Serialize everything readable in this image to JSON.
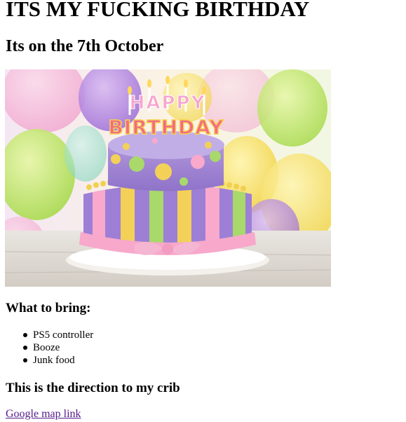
{
  "heading": "ITS MY FUCKING BIRTHDAY",
  "subheading": "Its on the 7th October",
  "image": {
    "cake_topper_line1": "HAPPY",
    "cake_topper_line2": "BIRTHDAY"
  },
  "bring_section": {
    "title": "What to bring:",
    "items": [
      "PS5 controller",
      "Booze",
      "Junk food"
    ]
  },
  "directions": {
    "title": "This is the direction to my crib",
    "link_text": "Google map link"
  },
  "colors": {
    "visited_link": "#551a8b",
    "text": "#000000",
    "background": "#ffffff"
  }
}
